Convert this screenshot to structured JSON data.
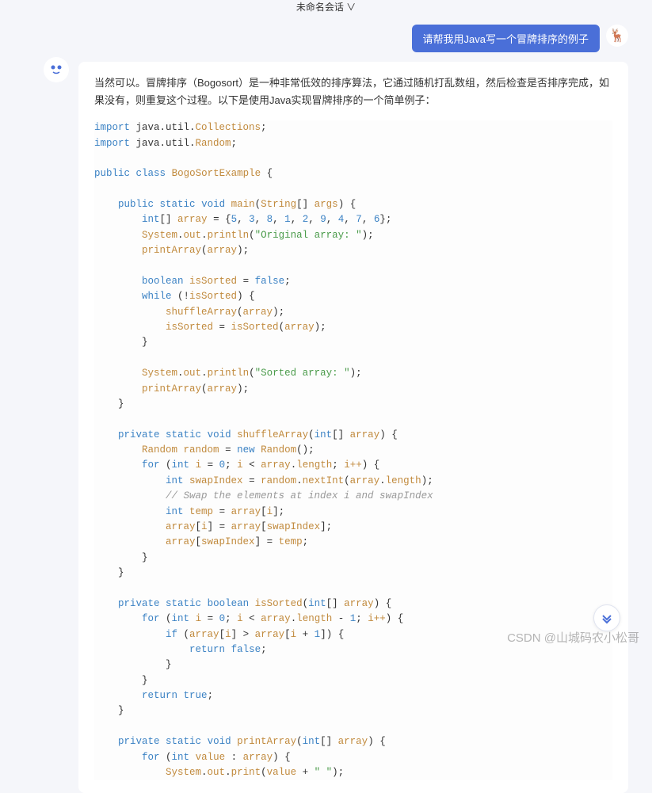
{
  "header": {
    "title": "未命名会话 ∨"
  },
  "user_message": {
    "text": "请帮我用Java写一个冒牌排序的例子",
    "avatar_emoji": "🦌"
  },
  "bot": {
    "avatar_emoji": "😀",
    "intro": "当然可以。冒牌排序（Bogosort）是一种非常低效的排序算法，它通过随机打乱数组，然后检查是否排序完成，如果没有，则重复这个过程。以下是使用Java实现冒牌排序的一个简单例子："
  },
  "code": {
    "import1_kw": "import",
    "import1_pkg": " java.util.",
    "import1_cls": "Collections",
    "import2_kw": "import",
    "import2_pkg": " java.util.",
    "import2_cls": "Random",
    "public": "public",
    "class": "class",
    "classname": "BogoSortExample",
    "static": "static",
    "void": "void",
    "main": "main",
    "string": "String",
    "args": "args",
    "int": "int",
    "array_decl": "array",
    "nums": "{5, 3, 8, 1, 2, 9, 4, 7, 6}",
    "n5": "5",
    "n3": "3",
    "n8": "8",
    "n1": "1",
    "n2": "2",
    "n9": "9",
    "n4": "4",
    "n7": "7",
    "n6": "6",
    "system": "System",
    "out": "out",
    "println": "println",
    "print": "print",
    "str_orig": "\"Original array: \"",
    "printArray": "printArray",
    "boolean": "boolean",
    "isSorted": "isSorted",
    "false": "false",
    "true": "true",
    "while": "while",
    "shuffleArray": "shuffleArray",
    "str_sorted": "\"Sorted array: \"",
    "private": "private",
    "random_cls": "Random",
    "random_var": "random",
    "new": "new",
    "for": "for",
    "i": "i",
    "zero": "0",
    "length": "length",
    "ipp": "i++",
    "swapIndex": "swapIndex",
    "nextInt": "nextInt",
    "comment_swap": "// Swap the elements at index i and swapIndex",
    "temp": "temp",
    "one": "1",
    "if": "if",
    "return": "return",
    "value": "value",
    "str_space": "\" \""
  },
  "watermark": "CSDN @山城码农小松哥"
}
